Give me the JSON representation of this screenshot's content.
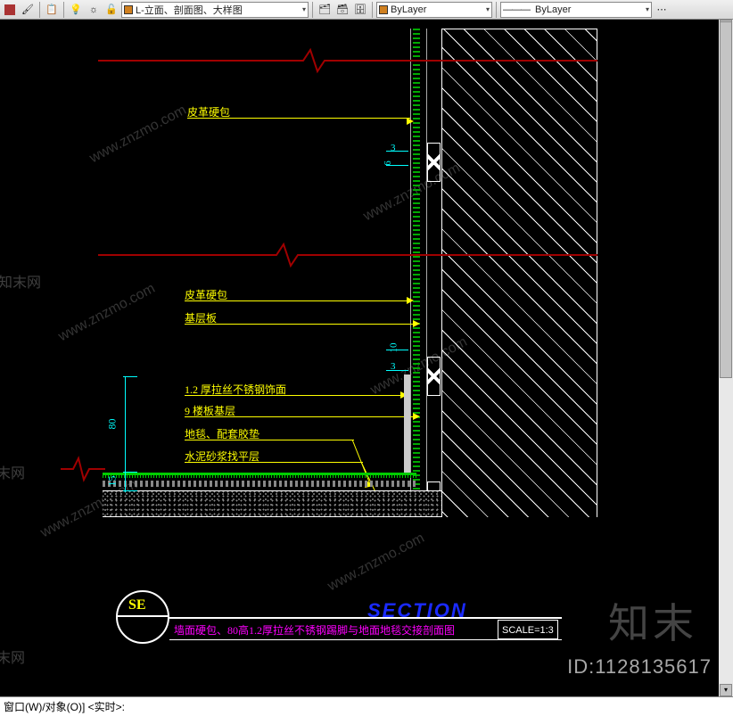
{
  "toolbar": {
    "layer_combo": "L-立面、剖面图、大样图",
    "color_combo": "ByLayer",
    "ltype_combo": "ByLayer",
    "color_swatch": "#d08020"
  },
  "drawing": {
    "labels": {
      "l1": "皮革硬包",
      "l2": "皮革硬包",
      "l3": "基层板",
      "l4": "1.2 厚拉丝不锈钢饰面",
      "l5": "9 楼板基层",
      "l6": "地毯、配套胶垫",
      "l7": "水泥砂浆找平层"
    },
    "dims": {
      "d1": "3",
      "d2": "6",
      "d3": "10",
      "d4": "3",
      "d_v1": "80",
      "d_v2": "15"
    },
    "section_tag": "SE",
    "section_word": "SECTION",
    "title": "墙面硬包、80高1.2厚拉丝不锈钢踢脚与地面地毯交接剖面图",
    "scale": "SCALE=1:3"
  },
  "cmdline": "窗口(W)/对象(O)] <实时>:",
  "watermark_url": "www.znzmo.com",
  "watermark_cn": "知末网",
  "watermark_logo": "知末",
  "id_label": "ID:1128135617"
}
